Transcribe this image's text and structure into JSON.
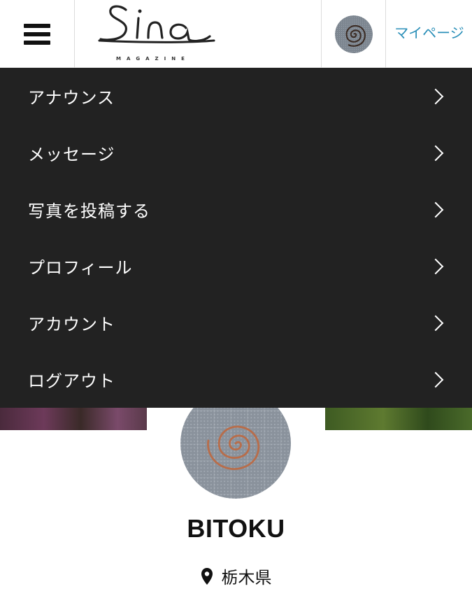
{
  "header": {
    "logo_text": "Sina",
    "logo_sub": "MAGAZINE",
    "mypage_label": "マイページ"
  },
  "menu": {
    "items": [
      {
        "label": "アナウンス"
      },
      {
        "label": "メッセージ"
      },
      {
        "label": "写真を投稿する"
      },
      {
        "label": "プロフィール"
      },
      {
        "label": "アカウント"
      },
      {
        "label": "ログアウト"
      }
    ]
  },
  "profile": {
    "username": "BITOKU",
    "location": "栃木県"
  },
  "colors": {
    "menu_bg": "#222222",
    "accent": "#2a8fb8",
    "text": "#111111"
  },
  "icons": {
    "menu": "hamburger-icon",
    "chevron": "chevron-right-icon",
    "location": "location-pin-icon"
  }
}
